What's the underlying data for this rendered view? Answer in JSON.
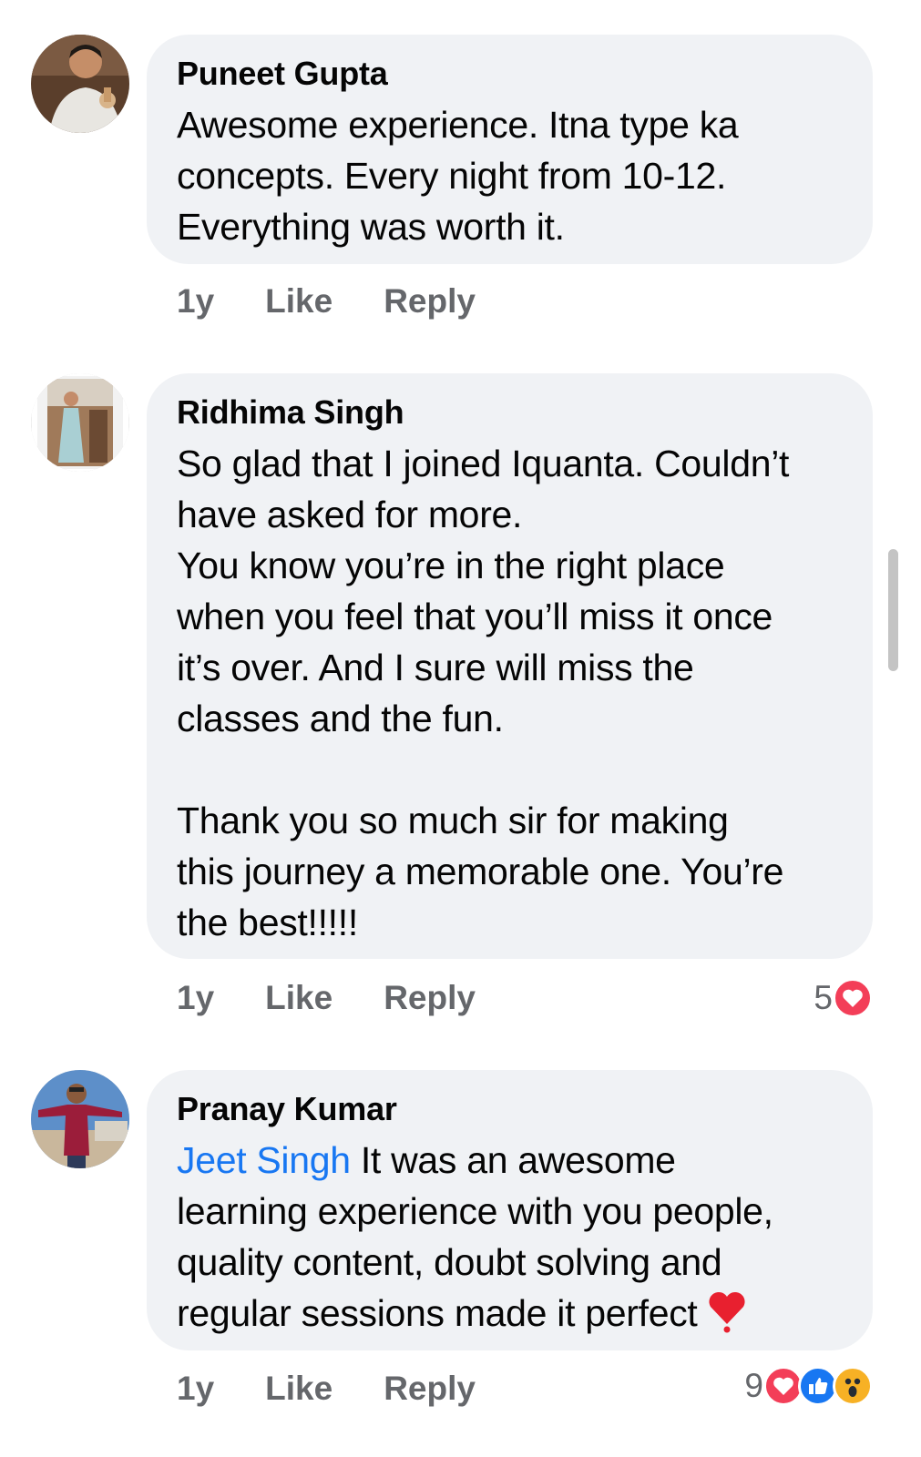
{
  "comments": [
    {
      "author": "Puneet Gupta",
      "mention": "",
      "text": "Awesome experience. Itna type ka\nconcepts. Every night from 10-12.\nEverything was worth it.",
      "time": "1y",
      "like_label": "Like",
      "reply_label": "Reply",
      "reaction_count": "",
      "reactions": []
    },
    {
      "author": "Ridhima Singh",
      "mention": "",
      "text": "So glad that I joined Iquanta. Couldn’t\nhave asked for more.\nYou know you’re in the right place\nwhen you feel that you’ll miss it once\nit’s over. And I sure will miss the\nclasses and the fun.\n\nThank you so much sir for making\nthis journey a memorable one. You’re\nthe best!!!!!",
      "time": "1y",
      "like_label": "Like",
      "reply_label": "Reply",
      "reaction_count": "5",
      "reactions": [
        "love"
      ]
    },
    {
      "author": "Pranay Kumar",
      "mention": "Jeet Singh",
      "text": " It was an awesome\nlearning experience with you people,\nquality content, doubt solving and\nregular sessions made it perfect",
      "time": "1y",
      "like_label": "Like",
      "reply_label": "Reply",
      "reaction_count": "9",
      "reactions": [
        "love",
        "like",
        "wow"
      ]
    }
  ],
  "colors": {
    "bubble": "#f0f2f5",
    "mention": "#1877f2",
    "meta": "#65676b",
    "love": "#f33e58",
    "like": "#1877f2",
    "wow": "#f7b125"
  }
}
